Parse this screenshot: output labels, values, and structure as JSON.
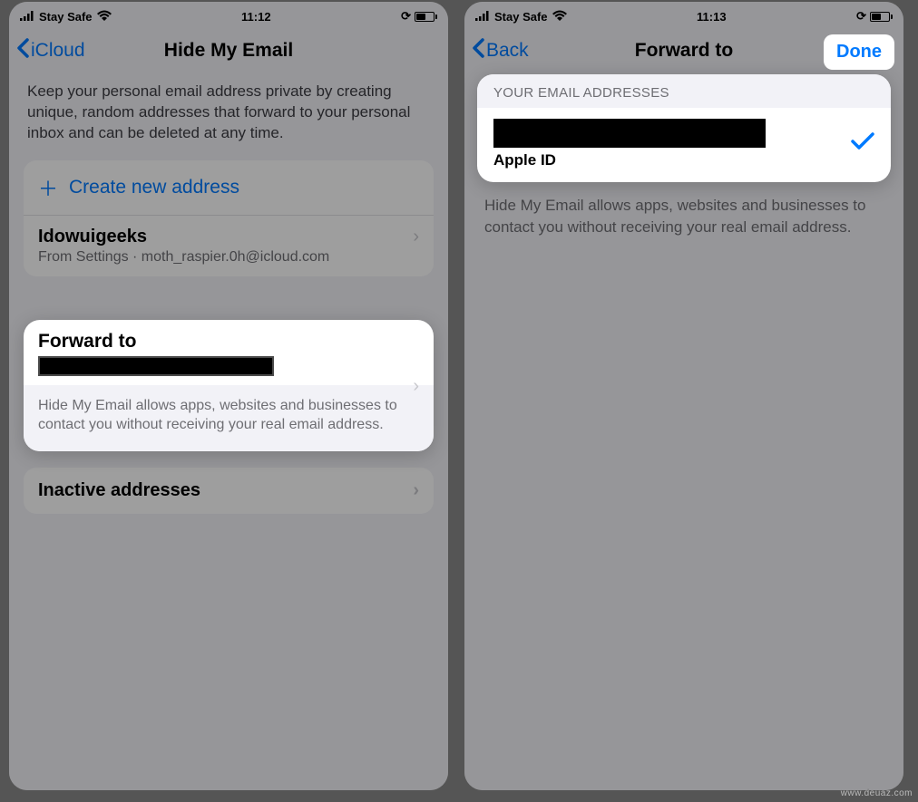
{
  "left": {
    "statusCarrier": "Stay Safe",
    "statusTime": "11:12",
    "navBack": "iCloud",
    "navTitle": "Hide My Email",
    "intro": "Keep your personal email address private by creating unique, random addresses that forward to your personal inbox and can be deleted at any time.",
    "createLabel": "Create new address",
    "addressName": "Idowuigeeks",
    "addressSub": "From Settings · moth_raspier.0h@icloud.com",
    "forwardTitle": "Forward to",
    "forwardFooter": "Hide My Email allows apps, websites and businesses to contact you without receiving your real email address.",
    "inactiveLabel": "Inactive addresses"
  },
  "right": {
    "statusCarrier": "Stay Safe",
    "statusTime": "11:13",
    "navBack": "Back",
    "navTitle": "Forward to",
    "navDone": "Done",
    "sectionHeader": "YOUR EMAIL ADDRESSES",
    "appleIdLabel": "Apple ID",
    "footer": "Hide My Email allows apps, websites and businesses to contact you without receiving your real email address."
  },
  "watermark": "www.deuaz.com"
}
